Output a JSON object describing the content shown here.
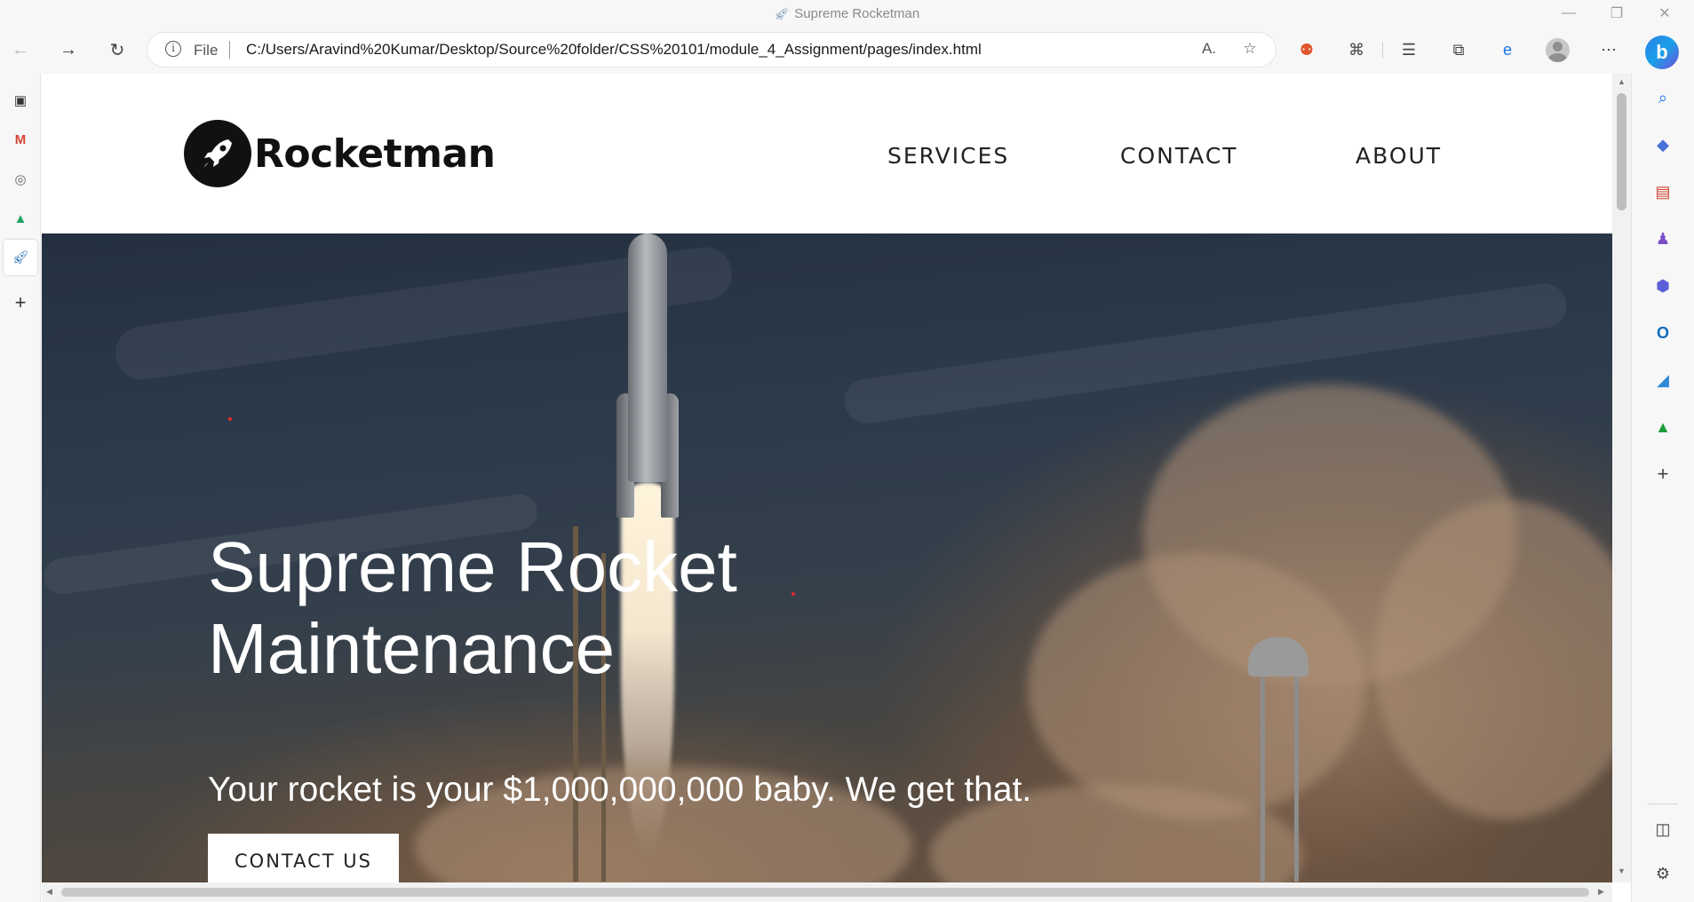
{
  "window": {
    "title": "Supreme Rocketman"
  },
  "toolbar": {
    "url_scheme": "File",
    "url": "C:/Users/Aravind%20Kumar/Desktop/Source%20folder/CSS%20101/module_4_Assignment/pages/index.html"
  },
  "site": {
    "logo_text": "Rocketman",
    "nav": [
      "SERVICES",
      "CONTACT",
      "ABOUT"
    ],
    "hero": {
      "title": "Supreme Rocket Maintenance",
      "subtitle": "Your rocket is your $1,000,000,000 baby. We get that.",
      "cta_label": "CONTACT US"
    }
  },
  "colors": {
    "accent_edge_blue": "#1a73e8",
    "logo_black": "#111111",
    "hero_overlay": "#24303f"
  },
  "icons": {
    "sidebar": [
      "search-icon",
      "shopping-tag-icon",
      "toolbox-icon",
      "games-icon",
      "microsoft-365-icon",
      "outlook-icon",
      "drop-icon",
      "tree-icon",
      "add-icon"
    ]
  }
}
